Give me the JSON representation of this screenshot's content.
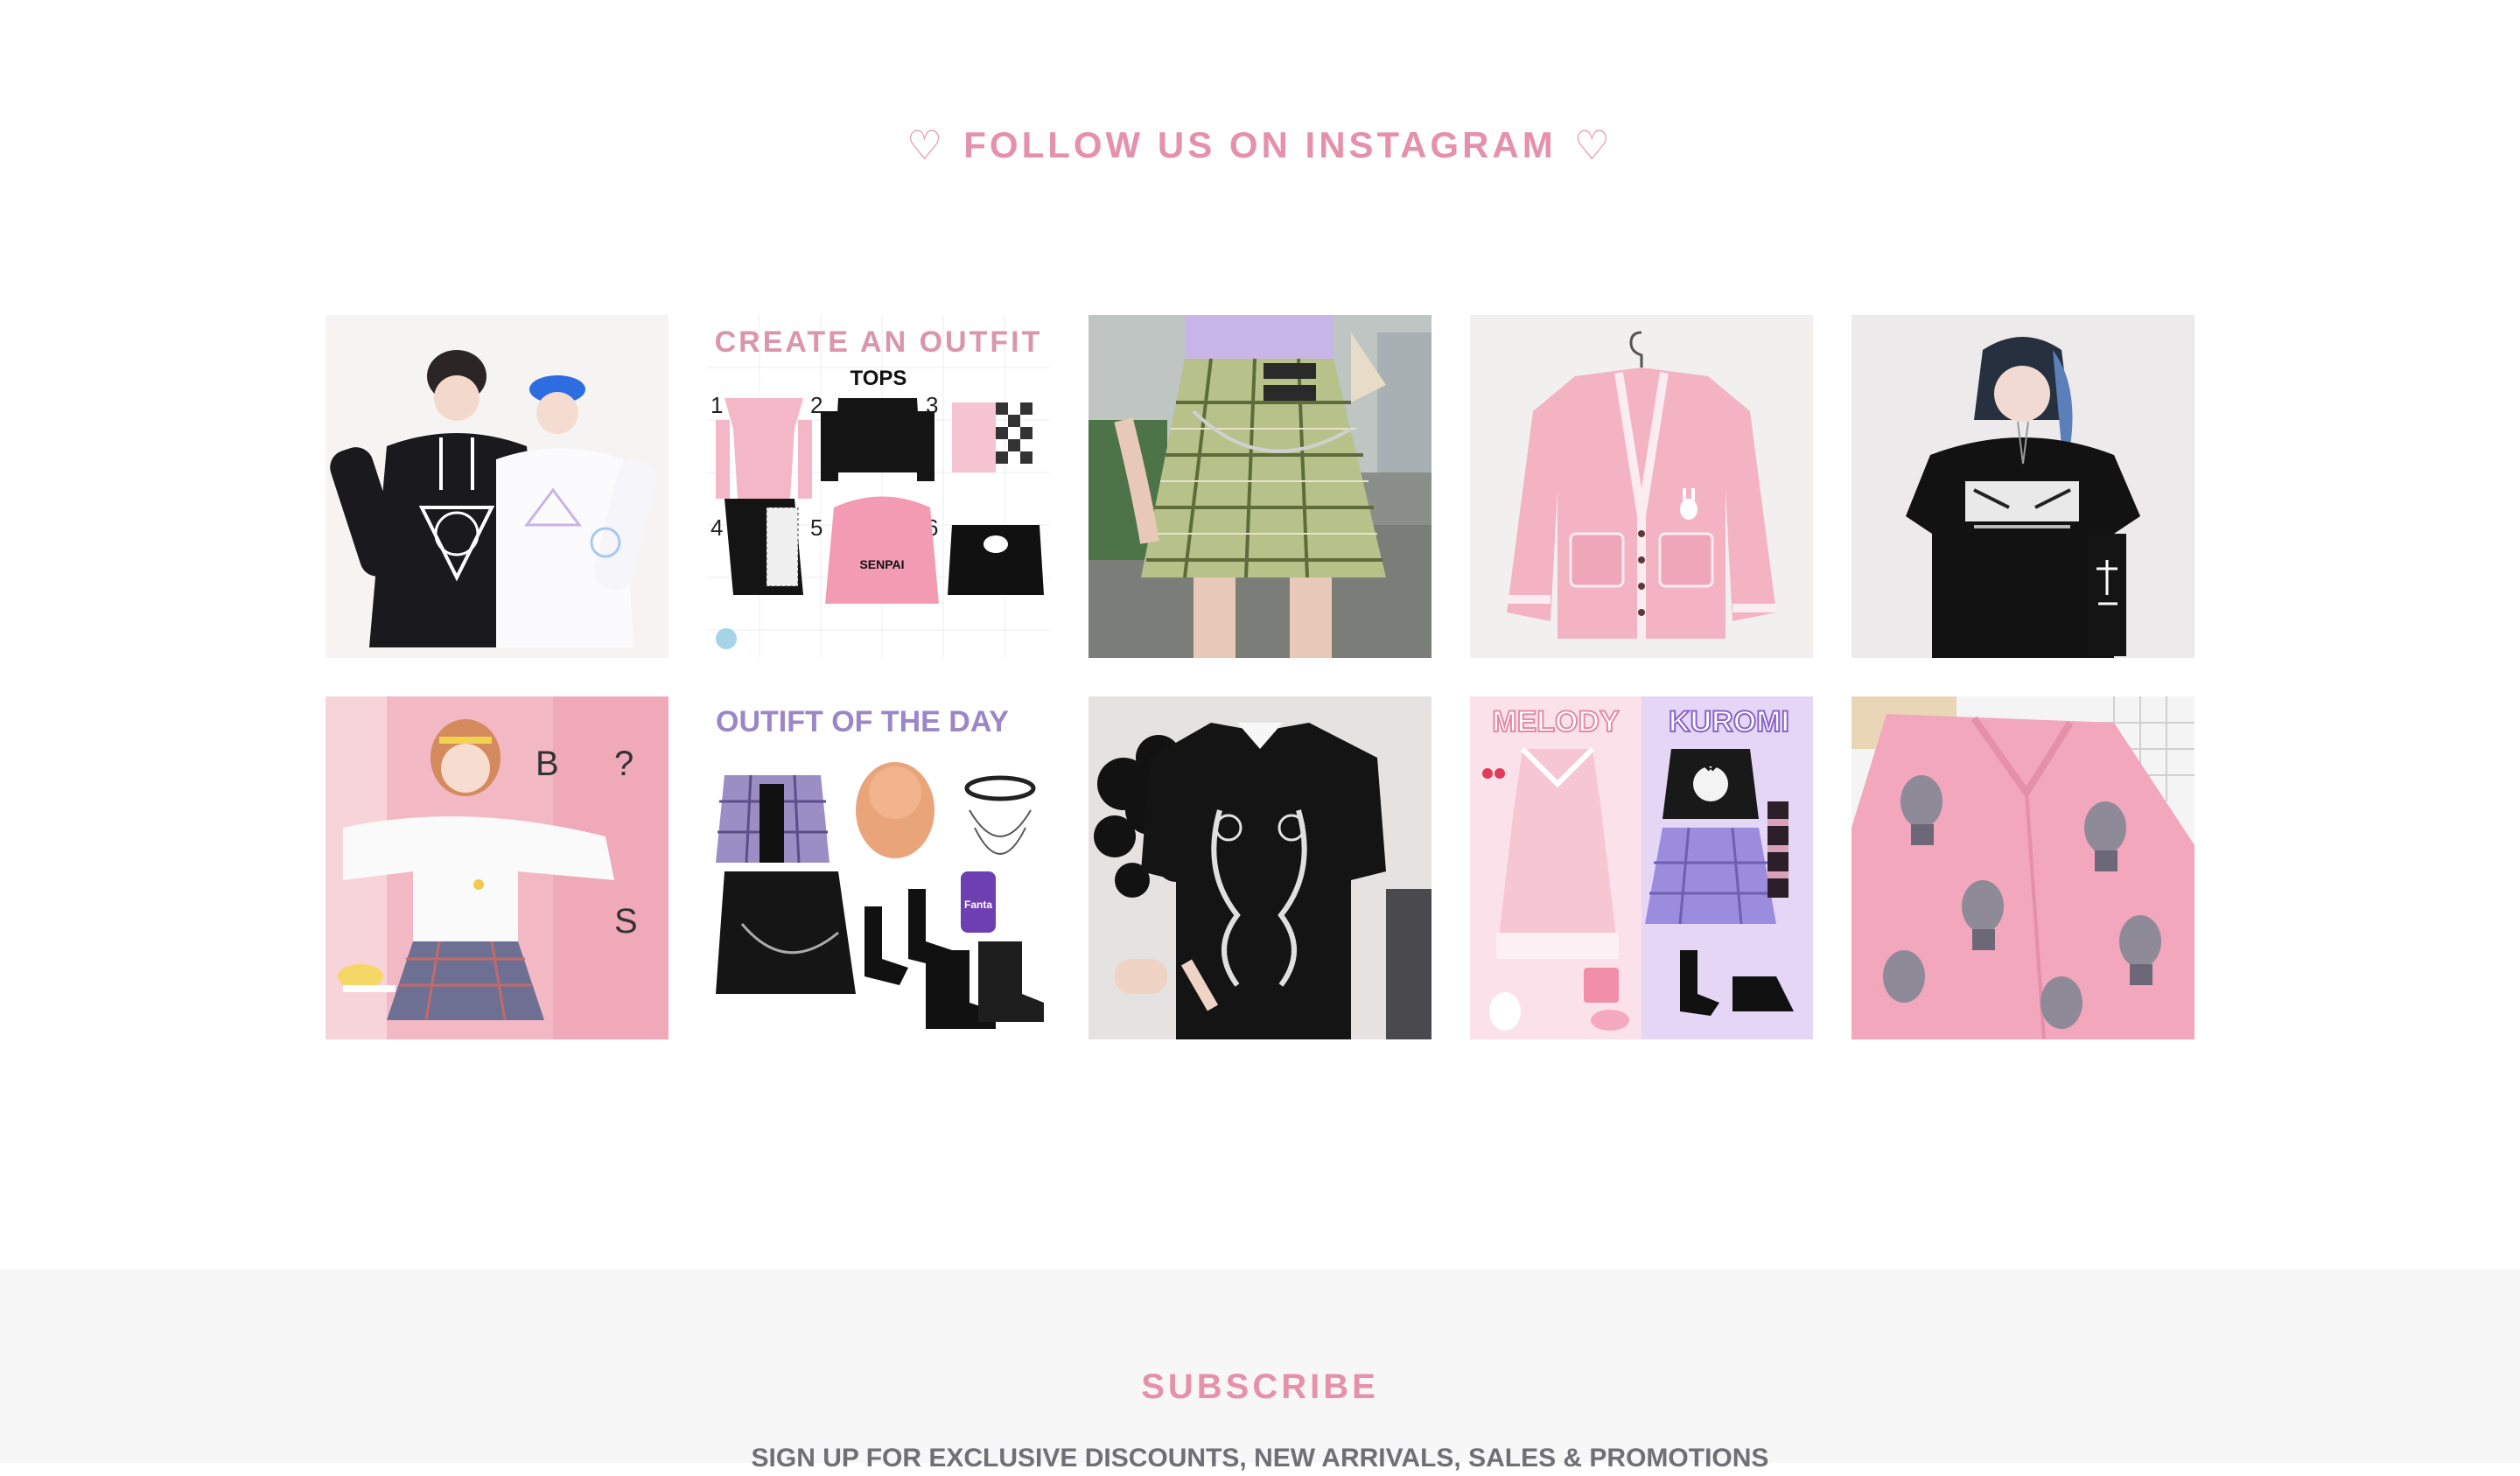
{
  "instagram": {
    "heart_left": "♡",
    "heading": "FOLLOW US ON INSTAGRAM",
    "heart_right": "♡",
    "accent_color": "#e591ab",
    "tiles": [
      {
        "row": 1,
        "col": 1,
        "subject": "two models in black and white bunny hoodies with caps"
      },
      {
        "row": 1,
        "col": 2,
        "graphic_title": "CREATE AN OUTFIT",
        "graphic_subtitle": "TOPS",
        "numbers": [
          "1",
          "2",
          "3",
          "4",
          "5",
          "6"
        ],
        "hoodie_text": "SENPAI"
      },
      {
        "row": 1,
        "col": 3,
        "subject": "green plaid pleated skirt with chain and lilac crop top"
      },
      {
        "row": 1,
        "col": 4,
        "subject": "pink knit cardigan with bunny patch on hanger"
      },
      {
        "row": 1,
        "col": 5,
        "subject": "model in black anime print t-shirt with arm warmer"
      },
      {
        "row": 2,
        "col": 1,
        "subject": "model in white hoodie and plaid skirt against pink background"
      },
      {
        "row": 2,
        "col": 2,
        "graphic_title": "OUTIFT OF THE DAY",
        "soda_text": "Fanta"
      },
      {
        "row": 2,
        "col": 3,
        "subject": "black polo dress with white dragon print holding black flowers"
      },
      {
        "row": 2,
        "col": 4,
        "graphic_title_left": "MELODY",
        "graphic_title_right": "KUROMI"
      },
      {
        "row": 2,
        "col": 5,
        "subject": "pink shirt with statue print"
      }
    ]
  },
  "subscribe": {
    "title": "SUBSCRIBE",
    "subtitle": "SIGN UP FOR EXCLUSIVE DISCOUNTS, NEW ARRIVALS, SALES & PROMOTIONS",
    "background_color": "#f7f7f7"
  }
}
